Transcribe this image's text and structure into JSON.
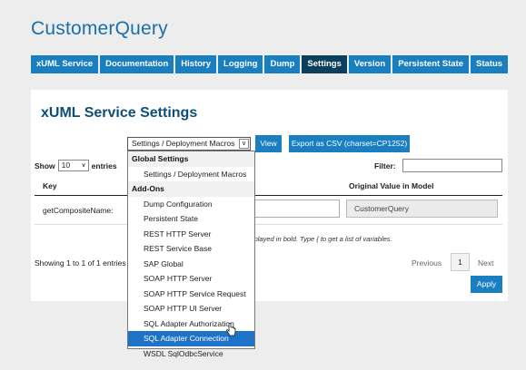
{
  "app": {
    "title": "CustomerQuery"
  },
  "tabs": [
    {
      "label": "xUML Service",
      "active": false
    },
    {
      "label": "Documentation",
      "active": false
    },
    {
      "label": "History",
      "active": false
    },
    {
      "label": "Logging",
      "active": false
    },
    {
      "label": "Dump",
      "active": false
    },
    {
      "label": "Settings",
      "active": true
    },
    {
      "label": "Version",
      "active": false
    },
    {
      "label": "Persistent State",
      "active": false
    },
    {
      "label": "Status",
      "active": false
    }
  ],
  "panel": {
    "title": "xUML Service Settings",
    "settings_select_value": "Settings / Deployment Macros",
    "view_button": "View",
    "export_button": "Export as CSV (charset=CP1252)",
    "show_label": "Show",
    "entries_value": "10",
    "entries_label": "entries",
    "filter_label": "Filter:",
    "filter_value": "",
    "columns": {
      "key": "Key",
      "original": "Original Value in Model"
    },
    "rows": [
      {
        "key": "getCompositeName:",
        "value": "",
        "original": "CustomerQuery"
      }
    ],
    "hint": "displayed in bold. Type { to get a list of variables.",
    "showing": "Showing 1 to 1 of 1 entries",
    "previous": "Previous",
    "page": "1",
    "next": "Next",
    "apply": "Apply"
  },
  "dropdown": {
    "groups": [
      {
        "label": "Global Settings",
        "items": [
          "Settings / Deployment Macros"
        ]
      },
      {
        "label": "Add-Ons",
        "items": [
          "Dump Configuration",
          "Persistent State",
          "REST HTTP Server",
          "REST Service Base",
          "SAP Global",
          "SOAP HTTP Server",
          "SOAP HTTP Service Request",
          "SOAP HTTP UI Server",
          "SQL Adapter Authorization",
          "SQL Adapter Connection",
          "WSDL SqlOdbcService"
        ]
      }
    ],
    "selected": "SQL Adapter Connection"
  },
  "colors": {
    "accent": "#1a7fc0",
    "active_tab": "#0b3f5e",
    "title": "#1b6fa8",
    "selected": "#1e73c8"
  }
}
